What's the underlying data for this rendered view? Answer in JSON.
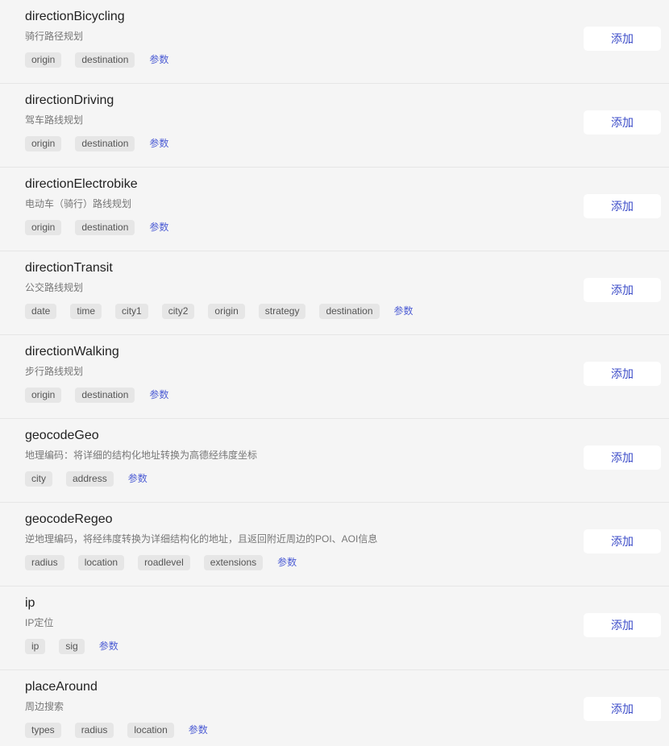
{
  "apis": [
    {
      "name": "directionBicycling",
      "desc": "骑行路径规划",
      "params": [
        "origin",
        "destination"
      ],
      "params_label": "参数",
      "add_label": "添加"
    },
    {
      "name": "directionDriving",
      "desc": "驾车路线规划",
      "params": [
        "origin",
        "destination"
      ],
      "params_label": "参数",
      "add_label": "添加"
    },
    {
      "name": "directionElectrobike",
      "desc": "电动车（骑行）路线规划",
      "params": [
        "origin",
        "destination"
      ],
      "params_label": "参数",
      "add_label": "添加"
    },
    {
      "name": "directionTransit",
      "desc": "公交路线规划",
      "params": [
        "date",
        "time",
        "city1",
        "city2",
        "origin",
        "strategy",
        "destination"
      ],
      "params_label": "参数",
      "add_label": "添加"
    },
    {
      "name": "directionWalking",
      "desc": "步行路线规划",
      "params": [
        "origin",
        "destination"
      ],
      "params_label": "参数",
      "add_label": "添加"
    },
    {
      "name": "geocodeGeo",
      "desc": "地理编码：将详细的结构化地址转换为高德经纬度坐标",
      "params": [
        "city",
        "address"
      ],
      "params_label": "参数",
      "add_label": "添加"
    },
    {
      "name": "geocodeRegeo",
      "desc": "逆地理编码，将经纬度转换为详细结构化的地址，且返回附近周边的POI、AOI信息",
      "params": [
        "radius",
        "location",
        "roadlevel",
        "extensions"
      ],
      "params_label": "参数",
      "add_label": "添加"
    },
    {
      "name": "ip",
      "desc": "IP定位",
      "params": [
        "ip",
        "sig"
      ],
      "params_label": "参数",
      "add_label": "添加"
    },
    {
      "name": "placeAround",
      "desc": "周边搜索",
      "params": [
        "types",
        "radius",
        "location"
      ],
      "params_label": "参数",
      "add_label": "添加"
    }
  ]
}
